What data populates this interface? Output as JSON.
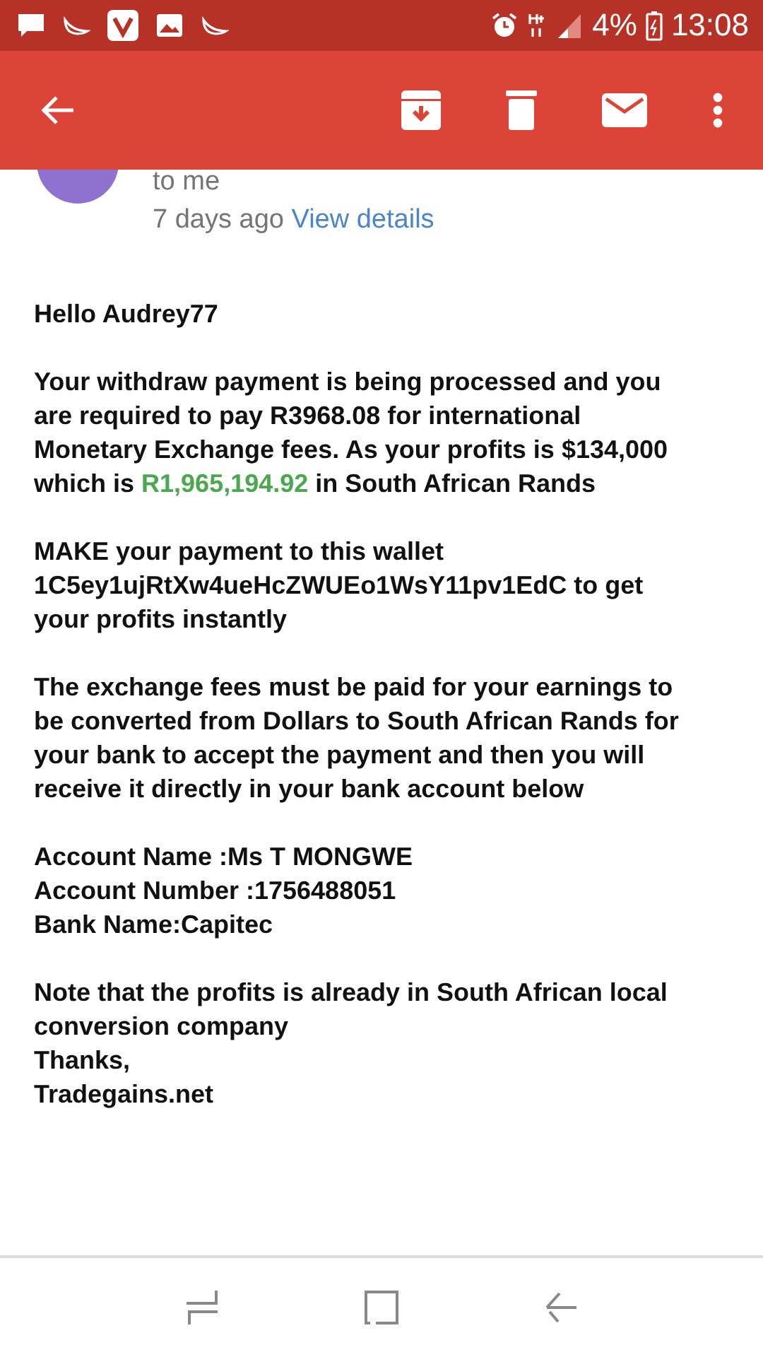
{
  "status_bar": {
    "battery": "4%",
    "time": "13:08"
  },
  "email": {
    "recipient": "to me",
    "age": "7 days ago",
    "details_link": "View details",
    "paragraphs": [
      {
        "parts": [
          {
            "text": "Hello Audrey77",
            "highlight": false
          }
        ]
      },
      {
        "parts": [
          {
            "text": "Your withdraw payment is being processed and you\nare required to pay R3968.08 for international\nMonetary Exchange fees. As your profits is $134,000\nwhich is ",
            "highlight": false
          },
          {
            "text": "R1,965,194.92",
            "highlight": true
          },
          {
            "text": " in South African Rands",
            "highlight": false
          }
        ]
      },
      {
        "parts": [
          {
            "text": "MAKE your payment to this wallet\n1C5ey1ujRtXw4ueHcZWUEo1WsY11pv1EdC to get\nyour profits instantly",
            "highlight": false
          }
        ]
      },
      {
        "parts": [
          {
            "text": "The exchange fees must be paid for your earnings to\nbe converted from Dollars to South African Rands for\nyour bank to accept the payment and then you will\nreceive it directly in your bank account below",
            "highlight": false
          }
        ]
      },
      {
        "parts": [
          {
            "text": "Account Name :Ms T MONGWE\nAccount Number :1756488051\nBank Name:Capitec",
            "highlight": false
          }
        ]
      },
      {
        "parts": [
          {
            "text": "Note that the profits is already in South African local\nconversion company\nThanks,\nTradegains.net",
            "highlight": false
          }
        ]
      }
    ]
  }
}
